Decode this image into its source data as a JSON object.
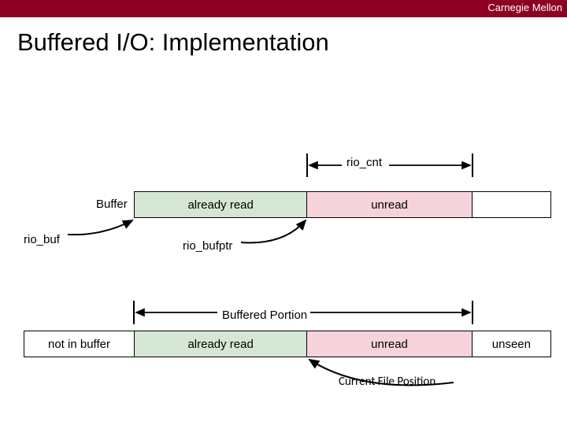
{
  "brand": "Carnegie Mellon",
  "title": "Buffered I/O: Implementation",
  "labels": {
    "rio_cnt": "rio_cnt",
    "buffer": "Buffer",
    "rio_buf": "rio_buf",
    "rio_bufptr": "rio_bufptr",
    "buffered_portion": "Buffered Portion",
    "current_file_position": "Current File Position"
  },
  "buffer_segments": [
    {
      "label": "already read",
      "flex": 220,
      "fill": "green"
    },
    {
      "label": "unread",
      "flex": 210,
      "fill": "pink"
    },
    {
      "label": "",
      "flex": 100,
      "fill": "none"
    }
  ],
  "portion_segments": [
    {
      "label": "not in buffer",
      "flex": 140,
      "fill": "none"
    },
    {
      "label": "already read",
      "flex": 220,
      "fill": "green"
    },
    {
      "label": "unread",
      "flex": 210,
      "fill": "pink"
    },
    {
      "label": "unseen",
      "flex": 100,
      "fill": "none"
    }
  ]
}
